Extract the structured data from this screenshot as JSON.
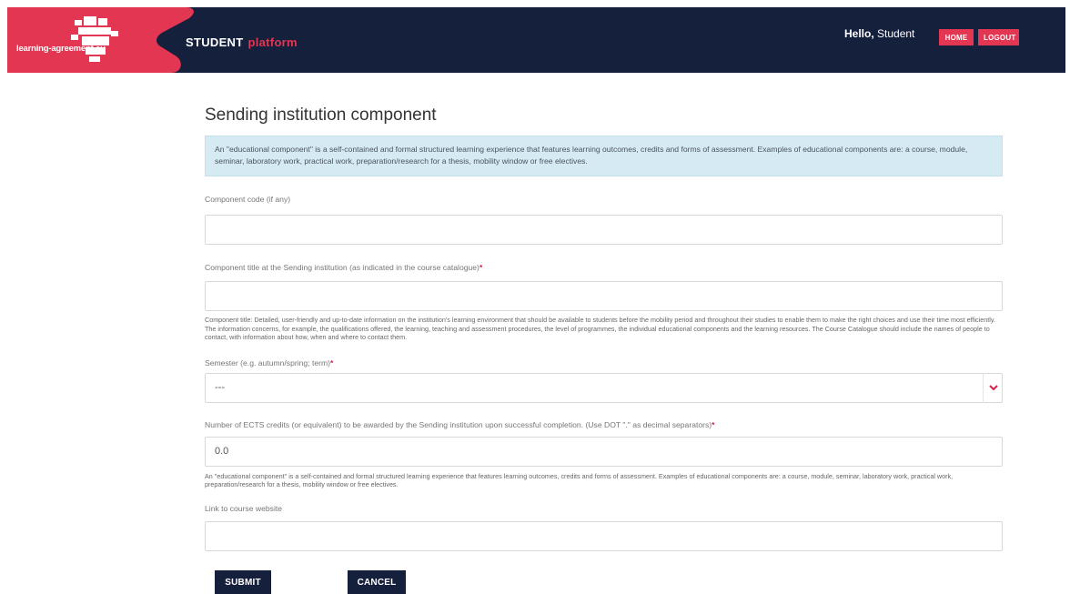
{
  "header": {
    "logo_text": "learning-agreement.eu",
    "platform_word1": "STUDENT",
    "platform_word2": "platform",
    "greeting_hello": "Hello,",
    "greeting_name": "Student",
    "home_label": "HOME",
    "logout_label": "LOGOUT"
  },
  "colors": {
    "navy": "#15203d",
    "accent": "#e23652",
    "info_bg": "#d6eaf4"
  },
  "page": {
    "title": "Sending institution component",
    "info_text": "An \"educational component\" is a self-contained and formal structured learning experience that features learning outcomes, credits and forms of assessment. Examples of educational components are: a course, module, seminar, laboratory work, practical work, preparation/research for a thesis, mobility window or free electives."
  },
  "form": {
    "component_code": {
      "label": "Component code (if any)",
      "value": ""
    },
    "component_title": {
      "label": "Component title at the Sending institution (as indicated in the course catalogue)",
      "required_mark": "*",
      "value": "",
      "help": "Component title: Detailed, user-friendly and up-to-date information on the institution's learning environment that should be available to students before the mobility period and throughout their studies to enable them to make the right choices and use their time most efficiently. The information concerns, for example, the qualifications offered, the learning, teaching and assessment procedures, the level of programmes, the individual educational components and the learning resources. The Course Catalogue should include the names of people to contact, with information about how, when and where to contact them."
    },
    "semester": {
      "label": "Semester (e.g. autumn/spring; term)",
      "required_mark": "*",
      "selected": "---",
      "arrow_icon": "chevron-down-icon"
    },
    "ects": {
      "label": "Number of ECTS credits (or equivalent) to be awarded by the Sending institution upon successful completion. (Use DOT \".\" as decimal separators)",
      "required_mark": "*",
      "value": "0.0",
      "help": "An \"educational component\" is a self-contained and formal structured learning experience that features learning outcomes, credits and forms of assessment. Examples of educational components are: a course, module, seminar, laboratory work, practical work, preparation/research for a thesis, mobility window or free electives."
    },
    "course_link": {
      "label": "Link to course website",
      "value": ""
    }
  },
  "actions": {
    "submit_label": "SUBMIT",
    "cancel_label": "CANCEL"
  }
}
